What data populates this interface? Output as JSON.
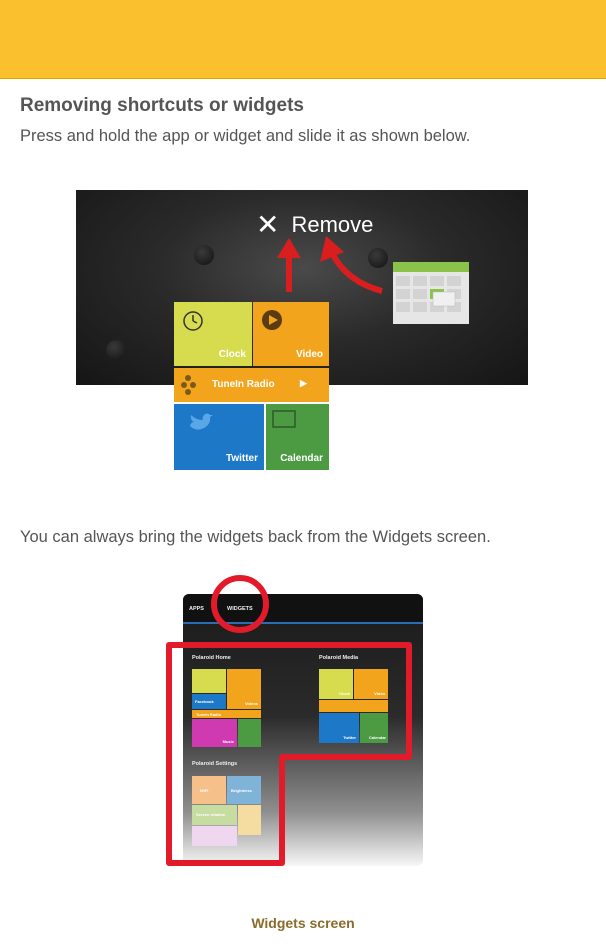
{
  "header_bar_color": "#fbc02d",
  "section": {
    "title": "Removing shortcuts or widgets",
    "instruction": "Press and hold the app or widget and slide it as shown below."
  },
  "demo": {
    "remove_label": "Remove",
    "tiles": {
      "clock": "Clock",
      "video": "Video",
      "tunein": "TuneIn Radio",
      "twitter": "Twitter",
      "calendar": "Calendar"
    }
  },
  "followup": "You can always bring the widgets back from the Widgets screen.",
  "widgets_screen": {
    "tabs": [
      "APPS",
      "WIDGETS"
    ],
    "sections": [
      "Polaroid Home",
      "Polaroid Media",
      "Polaroid Settings"
    ],
    "tiles": {
      "facebook": "Facebook",
      "videos": "Videos",
      "tunein": "TuneIn Radio",
      "music": "Music",
      "clock": "Clock",
      "video": "Video",
      "twitter": "Twitter",
      "calendar": "Calendar",
      "wifi": "WiFi",
      "brightness": "Brightness",
      "screen_rotation": "Screen rotation",
      "sleep": "Sleep"
    }
  },
  "caption": "Widgets screen"
}
